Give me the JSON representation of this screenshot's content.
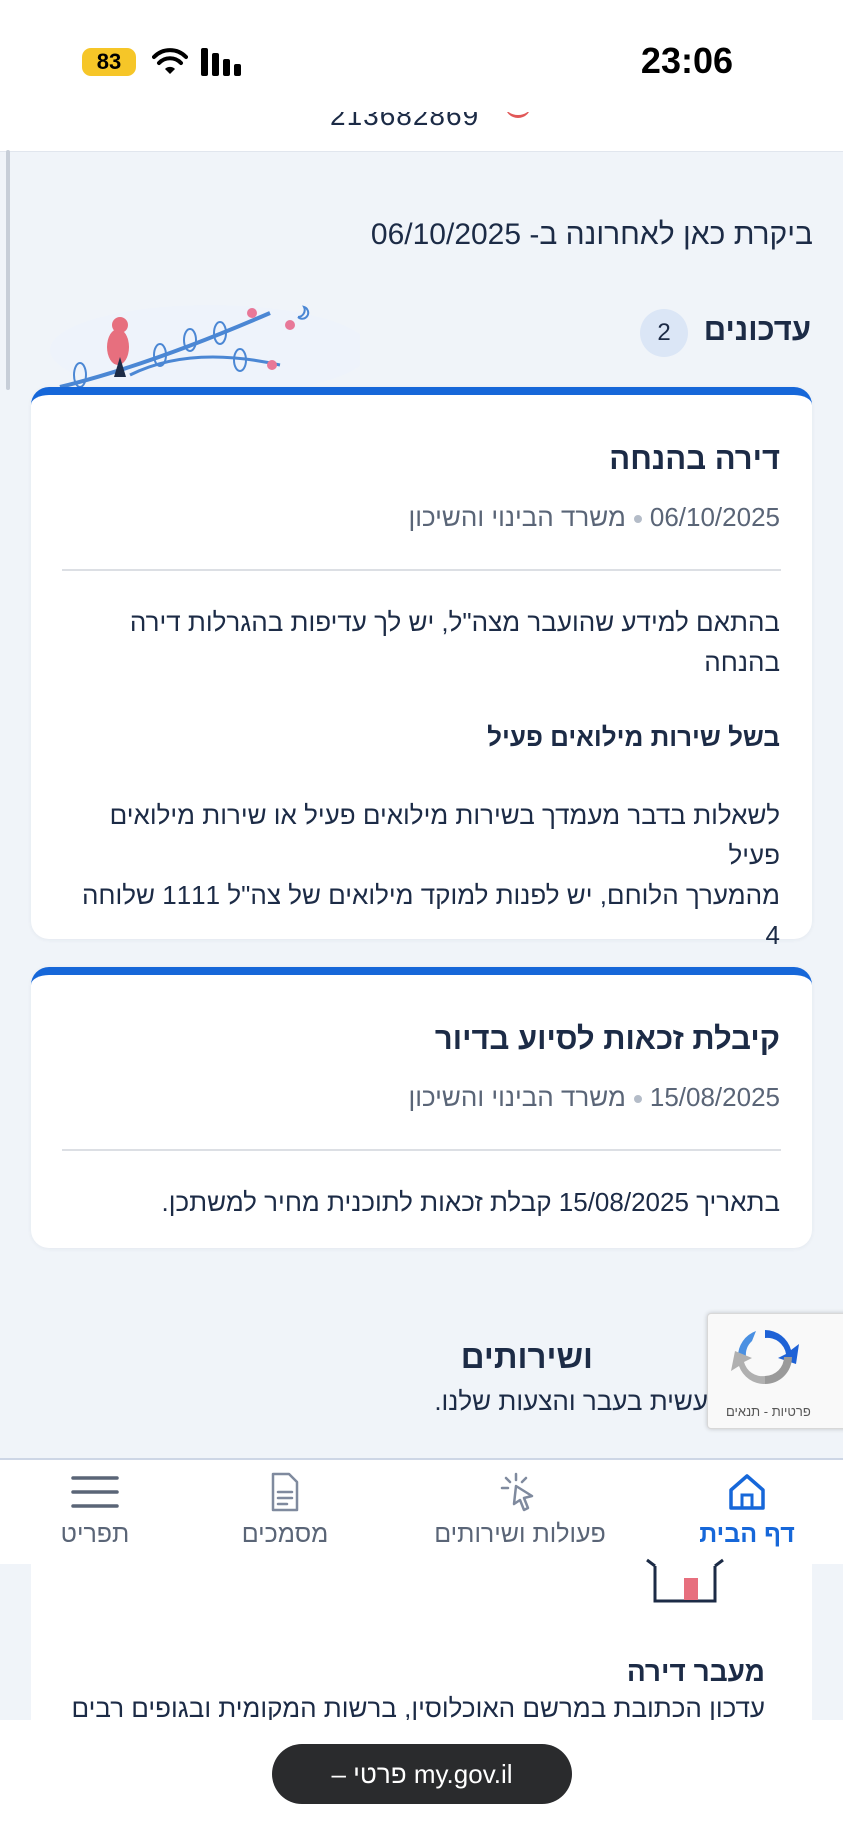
{
  "status_bar": {
    "time": "23:06",
    "battery": "83"
  },
  "header": {
    "id_number": "213682869"
  },
  "last_visit": {
    "text": "ביקרת כאן לאחרונה ב- 06/10/2025"
  },
  "updates": {
    "title": "עדכונים",
    "count": "2",
    "cards": [
      {
        "title": "דירה בהנחה",
        "date": "06/10/2025",
        "ministry": "משרד הבינוי והשיכון",
        "body_line1": "בהתאם למידע שהועבר מצה\"ל, יש לך עדיפות בהגרלות דירה",
        "body_line2": "בהנחה",
        "subtitle": "בשל שירות מילואים פעיל",
        "note_line1": "לשאלות בדבר מעמדך בשירות מילואים פעיל או שירות מילואים פעיל",
        "note_line2": "מהמערך הלוחם, יש לפנות למוקד מילואים של צה\"ל 1111 שלוחה 4"
      },
      {
        "title": "קיבלת זכאות לסיוע בדיור",
        "date": "15/08/2025",
        "ministry": "משרד הבינוי והשיכון",
        "body_line1": "בתאריך 15/08/2025 קבלת זכאות לתוכנית מחיר למשתכן."
      }
    ]
  },
  "services": {
    "title": "ושירותים",
    "subtitle": "עשית בעבר והצעות שלנו."
  },
  "recaptcha": {
    "links": "פרטיות - תנאים"
  },
  "bottom_nav": {
    "items": [
      {
        "label": "דף הבית",
        "icon": "home-icon",
        "active": true
      },
      {
        "label": "פעולות ושירותים",
        "icon": "click-icon"
      },
      {
        "label": "מסמכים",
        "icon": "document-icon"
      },
      {
        "label": "תפריט",
        "icon": "menu-icon"
      }
    ]
  },
  "moving": {
    "title": "מעבר דירה",
    "text": "עדכון הכתובת במרשם האוכלוסין, ברשות המקומית ובגופים רבים"
  },
  "browser": {
    "url_label": "my.gov.il פרטי –"
  },
  "colors": {
    "accent": "#1667d9",
    "text": "#1c2b46",
    "background": "#f0f4f9"
  }
}
